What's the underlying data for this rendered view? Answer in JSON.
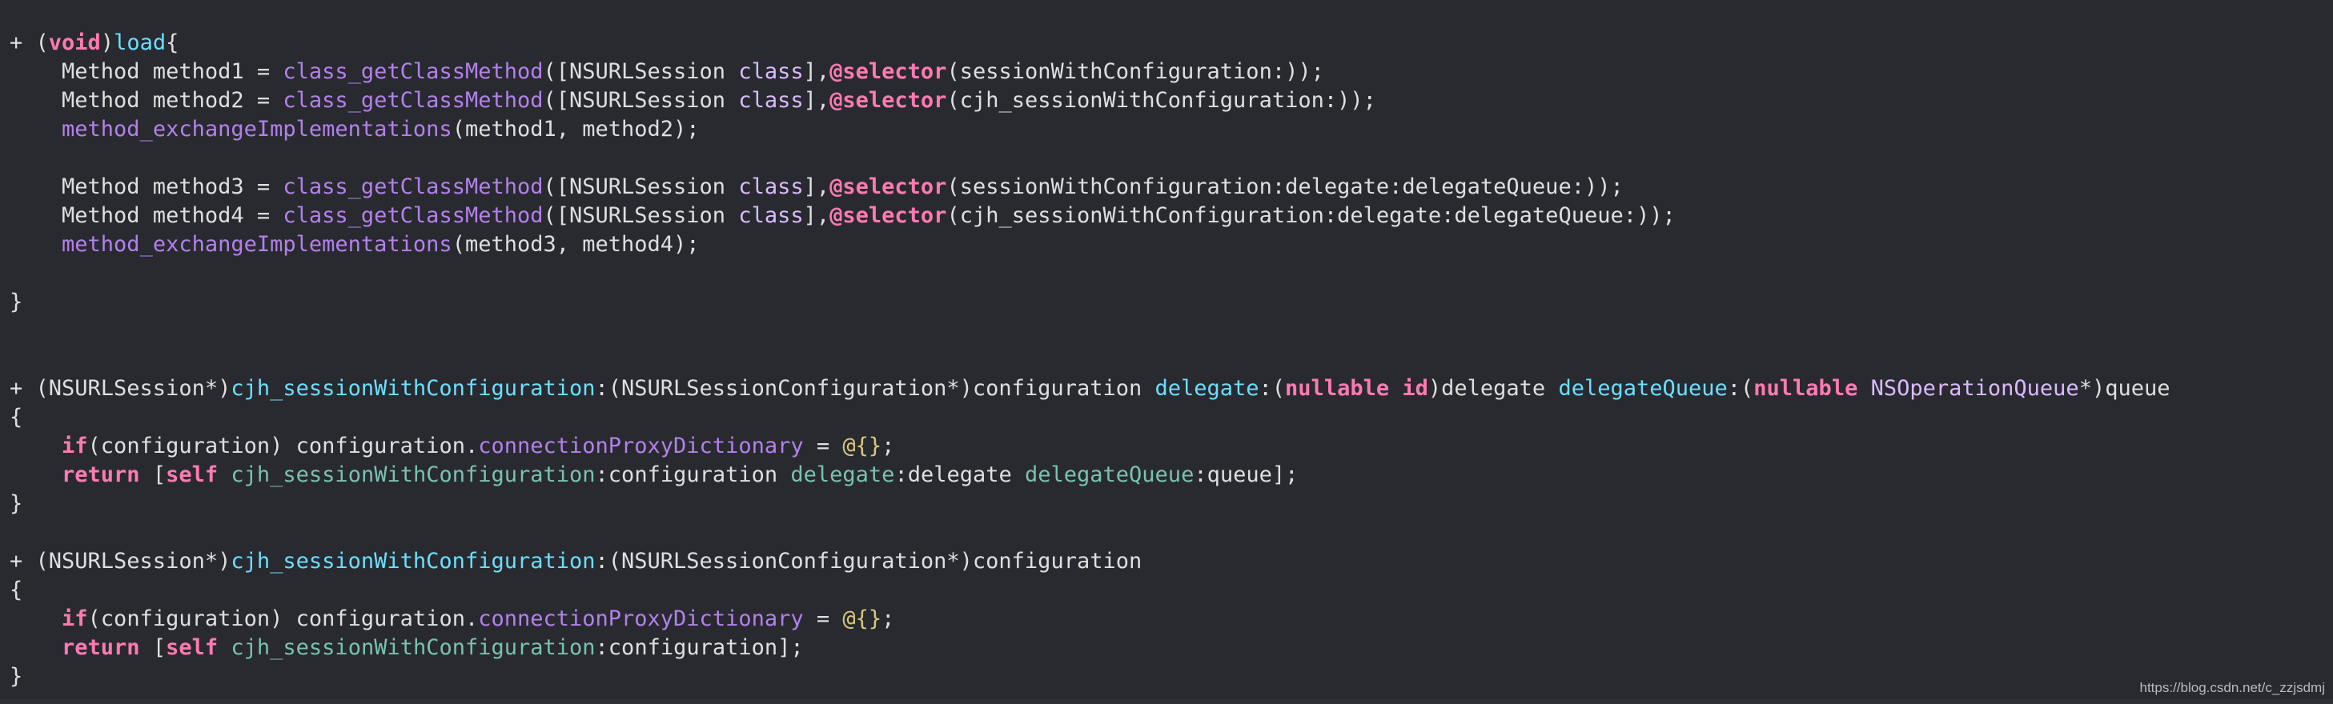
{
  "editor": {
    "theme_colors": {
      "background": "#292a30",
      "plain": "#dfdfe0",
      "keyword": "#ff7ab2",
      "function": "#b281eb",
      "type": "#dabaff",
      "class": "#6bdfff",
      "method": "#78c2b3",
      "literal": "#d9c97c"
    },
    "lines": [
      [
        {
          "t": "+ (",
          "c": "plain"
        },
        {
          "t": "void",
          "c": "kw"
        },
        {
          "t": ")",
          "c": "plain"
        },
        {
          "t": "load",
          "c": "cls"
        },
        {
          "t": "{",
          "c": "plain"
        }
      ],
      [
        {
          "t": "    Method method1 = ",
          "c": "plain"
        },
        {
          "t": "class_getClassMethod",
          "c": "func"
        },
        {
          "t": "([NSURLSession ",
          "c": "plain"
        },
        {
          "t": "class",
          "c": "type"
        },
        {
          "t": "],",
          "c": "plain"
        },
        {
          "t": "@selector",
          "c": "kw"
        },
        {
          "t": "(sessionWithConfiguration:));",
          "c": "plain"
        }
      ],
      [
        {
          "t": "    Method method2 = ",
          "c": "plain"
        },
        {
          "t": "class_getClassMethod",
          "c": "func"
        },
        {
          "t": "([NSURLSession ",
          "c": "plain"
        },
        {
          "t": "class",
          "c": "type"
        },
        {
          "t": "],",
          "c": "plain"
        },
        {
          "t": "@selector",
          "c": "kw"
        },
        {
          "t": "(cjh_sessionWithConfiguration:));",
          "c": "plain"
        }
      ],
      [
        {
          "t": "    ",
          "c": "plain"
        },
        {
          "t": "method_exchangeImplementations",
          "c": "func"
        },
        {
          "t": "(method1, method2);",
          "c": "plain"
        }
      ],
      [],
      [
        {
          "t": "    Method method3 = ",
          "c": "plain"
        },
        {
          "t": "class_getClassMethod",
          "c": "func"
        },
        {
          "t": "([NSURLSession ",
          "c": "plain"
        },
        {
          "t": "class",
          "c": "type"
        },
        {
          "t": "],",
          "c": "plain"
        },
        {
          "t": "@selector",
          "c": "kw"
        },
        {
          "t": "(sessionWithConfiguration:delegate:delegateQueue:));",
          "c": "plain"
        }
      ],
      [
        {
          "t": "    Method method4 = ",
          "c": "plain"
        },
        {
          "t": "class_getClassMethod",
          "c": "func"
        },
        {
          "t": "([NSURLSession ",
          "c": "plain"
        },
        {
          "t": "class",
          "c": "type"
        },
        {
          "t": "],",
          "c": "plain"
        },
        {
          "t": "@selector",
          "c": "kw"
        },
        {
          "t": "(cjh_sessionWithConfiguration:delegate:delegateQueue:));",
          "c": "plain"
        }
      ],
      [
        {
          "t": "    ",
          "c": "plain"
        },
        {
          "t": "method_exchangeImplementations",
          "c": "func"
        },
        {
          "t": "(method3, method4);",
          "c": "plain"
        }
      ],
      [],
      [
        {
          "t": "}",
          "c": "plain"
        }
      ],
      [],
      [],
      [
        {
          "t": "+ (NSURLSession*)",
          "c": "plain"
        },
        {
          "t": "cjh_sessionWithConfiguration",
          "c": "cls"
        },
        {
          "t": ":(NSURLSessionConfiguration*)configuration ",
          "c": "plain"
        },
        {
          "t": "delegate",
          "c": "cls"
        },
        {
          "t": ":(",
          "c": "plain"
        },
        {
          "t": "nullable",
          "c": "kw"
        },
        {
          "t": " ",
          "c": "plain"
        },
        {
          "t": "id",
          "c": "kw"
        },
        {
          "t": ")delegate ",
          "c": "plain"
        },
        {
          "t": "delegateQueue",
          "c": "cls"
        },
        {
          "t": ":(",
          "c": "plain"
        },
        {
          "t": "nullable",
          "c": "kw"
        },
        {
          "t": " ",
          "c": "plain"
        },
        {
          "t": "NSOperationQueue",
          "c": "type"
        },
        {
          "t": "*)queue",
          "c": "plain"
        }
      ],
      [
        {
          "t": "{",
          "c": "plain"
        }
      ],
      [
        {
          "t": "    ",
          "c": "plain"
        },
        {
          "t": "if",
          "c": "kw"
        },
        {
          "t": "(configuration) configuration.",
          "c": "plain"
        },
        {
          "t": "connectionProxyDictionary",
          "c": "func"
        },
        {
          "t": " = ",
          "c": "plain"
        },
        {
          "t": "@{}",
          "c": "lit"
        },
        {
          "t": ";",
          "c": "plain"
        }
      ],
      [
        {
          "t": "    ",
          "c": "plain"
        },
        {
          "t": "return",
          "c": "kw"
        },
        {
          "t": " [",
          "c": "plain"
        },
        {
          "t": "self",
          "c": "kw"
        },
        {
          "t": " ",
          "c": "plain"
        },
        {
          "t": "cjh_sessionWithConfiguration",
          "c": "method"
        },
        {
          "t": ":configuration ",
          "c": "plain"
        },
        {
          "t": "delegate",
          "c": "method"
        },
        {
          "t": ":delegate ",
          "c": "plain"
        },
        {
          "t": "delegateQueue",
          "c": "method"
        },
        {
          "t": ":queue];",
          "c": "plain"
        }
      ],
      [
        {
          "t": "}",
          "c": "plain"
        }
      ],
      [],
      [
        {
          "t": "+ (NSURLSession*)",
          "c": "plain"
        },
        {
          "t": "cjh_sessionWithConfiguration",
          "c": "cls"
        },
        {
          "t": ":(NSURLSessionConfiguration*)configuration",
          "c": "plain"
        }
      ],
      [
        {
          "t": "{",
          "c": "plain"
        }
      ],
      [
        {
          "t": "    ",
          "c": "plain"
        },
        {
          "t": "if",
          "c": "kw"
        },
        {
          "t": "(configuration) configuration.",
          "c": "plain"
        },
        {
          "t": "connectionProxyDictionary",
          "c": "func"
        },
        {
          "t": " = ",
          "c": "plain"
        },
        {
          "t": "@{}",
          "c": "lit"
        },
        {
          "t": ";",
          "c": "plain"
        }
      ],
      [
        {
          "t": "    ",
          "c": "plain"
        },
        {
          "t": "return",
          "c": "kw"
        },
        {
          "t": " [",
          "c": "plain"
        },
        {
          "t": "self",
          "c": "kw"
        },
        {
          "t": " ",
          "c": "plain"
        },
        {
          "t": "cjh_sessionWithConfiguration",
          "c": "method"
        },
        {
          "t": ":configuration];",
          "c": "plain"
        }
      ],
      [
        {
          "t": "}",
          "c": "plain"
        }
      ]
    ]
  },
  "watermark": "https://blog.csdn.net/c_zzjsdmj"
}
